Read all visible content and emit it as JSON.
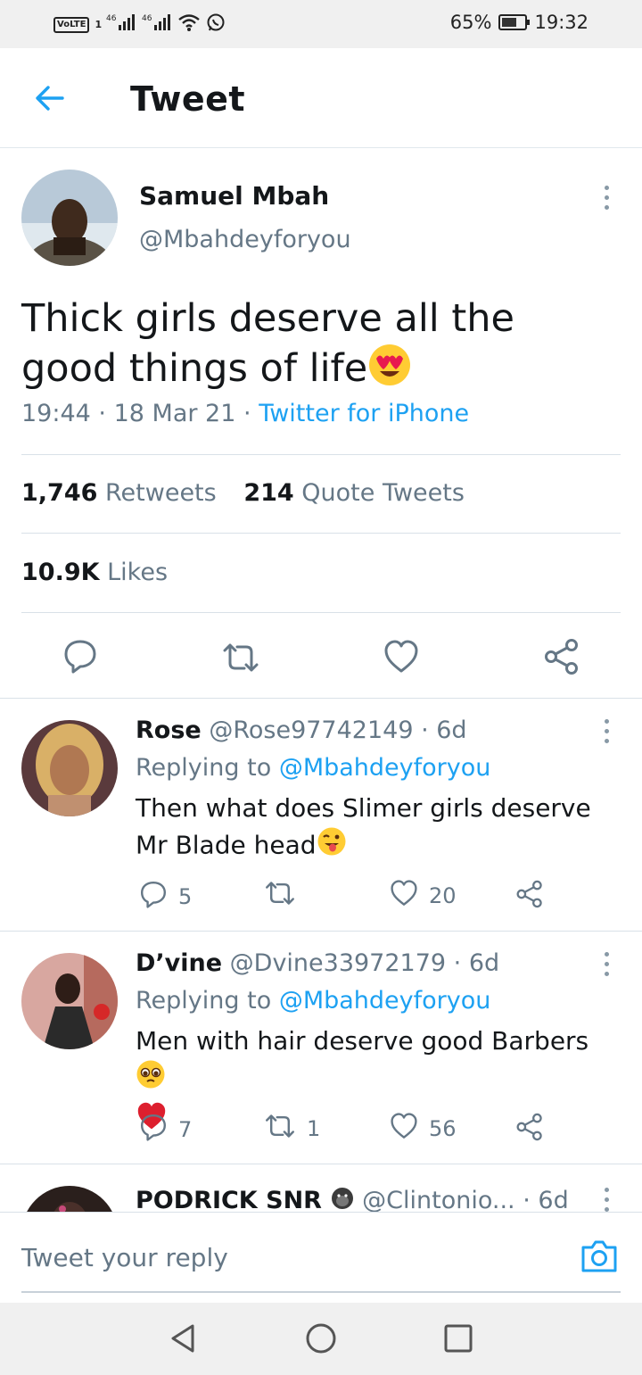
{
  "status_bar": {
    "volte": "VoLTE",
    "sim": "1",
    "net1": "46",
    "net2": "46",
    "battery": "65%",
    "battery_level": 0.65,
    "time": "19:32"
  },
  "app_bar": {
    "title": "Tweet"
  },
  "tweet": {
    "author_name": "Samuel Mbah",
    "author_handle": "@Mbahdeyforyou",
    "text": "Thick girls deserve all the good things of life",
    "emoji": "heart-eyes",
    "time": "19:44",
    "date": "18 Mar 21",
    "sep": "·",
    "source": "Twitter for iPhone",
    "retweets_count": "1,746",
    "retweets_label": "Retweets",
    "quotes_count": "214",
    "quotes_label": "Quote Tweets",
    "likes_count": "10.9K",
    "likes_label": "Likes"
  },
  "replies": [
    {
      "name": "Rose",
      "handle": "@Rose97742149",
      "age": "· 6d",
      "replying_label": "Replying to",
      "replying_handle": "@Mbahdeyforyou",
      "text": "Then what does Slimer girls deserve Mr Blade head",
      "replies": "5",
      "retweets": "",
      "likes": "20"
    },
    {
      "name": "D’vine",
      "handle": "@Dvine33972179",
      "age": "· 6d",
      "replying_label": "Replying to",
      "replying_handle": "@Mbahdeyforyou",
      "text": "Men with hair deserve good Barbers",
      "replies": "7",
      "retweets": "1",
      "likes": "56"
    },
    {
      "name": "PODRICK SNR",
      "handle": "@Clintonio...",
      "age": "· 6d"
    }
  ],
  "reply_bar": {
    "placeholder": "Tweet your reply"
  },
  "colors": {
    "link": "#1da1f2",
    "muted": "#657786",
    "text": "#14171a",
    "divider": "#d9e1e8"
  }
}
